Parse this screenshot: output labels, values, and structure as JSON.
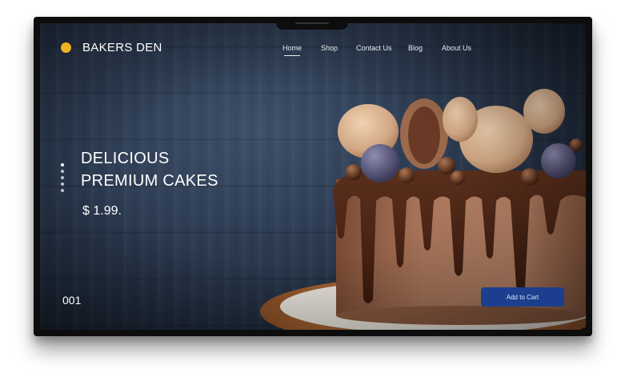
{
  "brand": {
    "name": "BAKERS DEN",
    "accent": "#f0b323"
  },
  "nav": [
    {
      "label": "Home",
      "active": true
    },
    {
      "label": "Shop",
      "active": false
    },
    {
      "label": "Contact Us",
      "active": false
    },
    {
      "label": "Blog",
      "active": false
    },
    {
      "label": "About Us",
      "active": false
    }
  ],
  "hero": {
    "title_line1": "DELICIOUS",
    "title_line2": "PREMIUM CAKES",
    "price": "$ 1.99."
  },
  "slider": {
    "current": "001",
    "dot_count": 5,
    "active_dot": 1
  },
  "cart_button": {
    "label": "Add to Cart",
    "color": "#1b3f8e"
  },
  "image": {
    "subject": "chocolate-drip-cake"
  }
}
